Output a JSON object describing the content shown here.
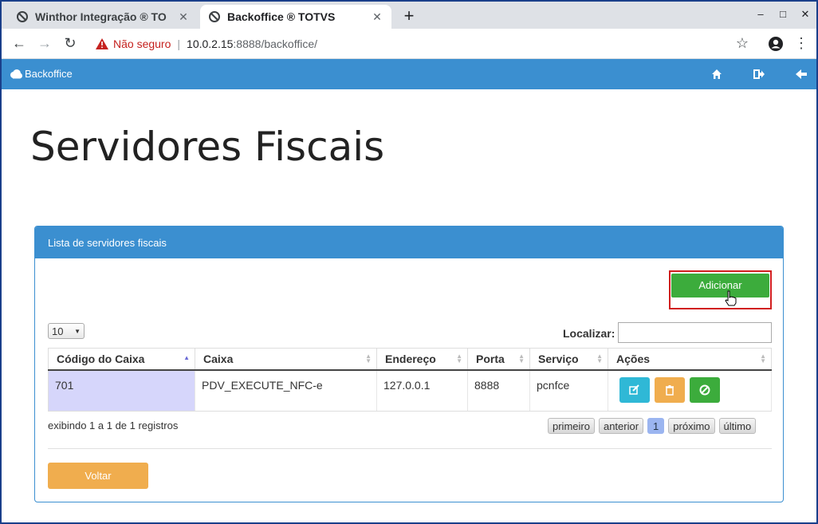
{
  "browser": {
    "tabs": [
      {
        "title": "Winthor Integração ® TO",
        "active": false
      },
      {
        "title": "Backoffice ® TOTVS",
        "active": true
      }
    ],
    "new_tab": "+",
    "window_controls": {
      "minimize": "–",
      "maximize": "□",
      "close": "✕"
    },
    "security_text": "Não seguro",
    "url_host": "10.0.2.15",
    "url_rest": ":8888/backoffice/"
  },
  "app": {
    "brand": "Backoffice",
    "header_icons": [
      "home-icon",
      "sign-out-icon",
      "arrow-left-icon"
    ],
    "accent_color": "#3b8fd0"
  },
  "page": {
    "title": "Servidores Fiscais",
    "panel_title": "Lista de servidores fiscais",
    "add_button": "Adicionar",
    "page_length": "10",
    "search_label": "Localizar:",
    "search_value": "",
    "columns": [
      "Código do Caixa",
      "Caixa",
      "Endereço",
      "Porta",
      "Serviço",
      "Ações"
    ],
    "rows": [
      {
        "codigo": "701",
        "caixa": "PDV_EXECUTE_NFC-e",
        "endereco": "127.0.0.1",
        "porta": "8888",
        "servico": "pcnfce"
      }
    ],
    "row_actions": [
      {
        "icon": "edit-icon",
        "color": "#2fb8d6"
      },
      {
        "icon": "trash-icon",
        "color": "#f0ad4e"
      },
      {
        "icon": "ban-icon",
        "color": "#3cac3c"
      }
    ],
    "info": "exibindo 1 a 1 de 1 registros",
    "pager": {
      "first": "primeiro",
      "prev": "anterior",
      "current": "1",
      "next": "próximo",
      "last": "último"
    },
    "back_button": "Voltar"
  }
}
